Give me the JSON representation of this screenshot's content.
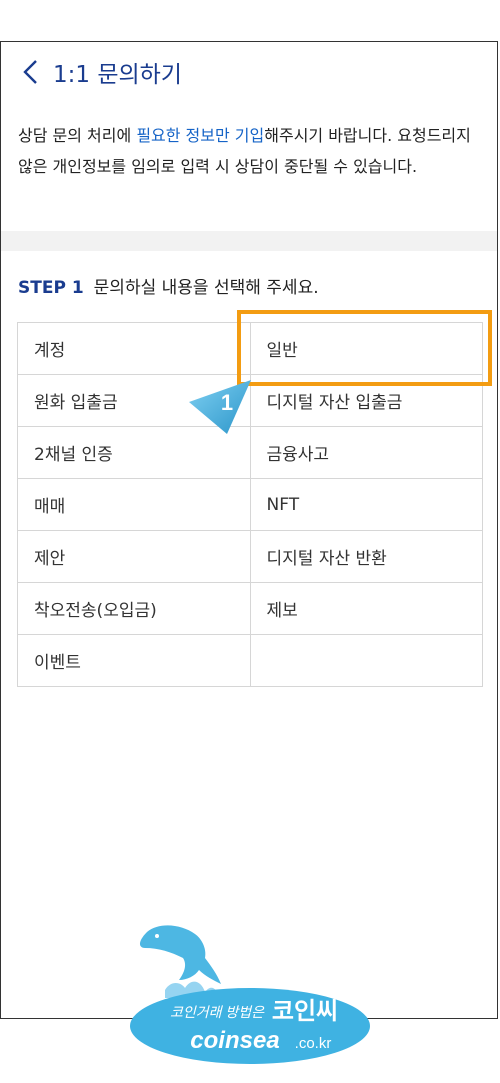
{
  "header": {
    "title": "1:1 문의하기",
    "back_icon": "chevron-left-icon"
  },
  "notice": {
    "before": "상담 문의 처리에 ",
    "highlight": "필요한 정보만 기입",
    "after": "해주시기 바랍니다. 요청드리지 않은 개인정보를 임의로 입력 시 상담이 중단될 수 있습니다."
  },
  "step": {
    "label": "STEP 1",
    "text": "문의하실 내용을 선택해 주세요."
  },
  "categories": {
    "r0": [
      "계정",
      "일반"
    ],
    "r1": [
      "원화 입출금",
      "디지털 자산 입출금"
    ],
    "r2": [
      "2채널 인증",
      "금융사고"
    ],
    "r3": [
      "매매",
      "NFT"
    ],
    "r4": [
      "제안",
      "디지털 자산 반환"
    ],
    "r5": [
      "착오전송(오입금)",
      "제보"
    ],
    "r6": [
      "이벤트",
      ""
    ]
  },
  "annotation": {
    "number": "1",
    "color": "#f39c12",
    "arrow_color": "#3aa7d9"
  },
  "watermark": {
    "line1": "코인거래 방법은",
    "brand_kr": "코인씨",
    "brand_en": "coinsea",
    "domain_suffix": ".co.kr"
  }
}
